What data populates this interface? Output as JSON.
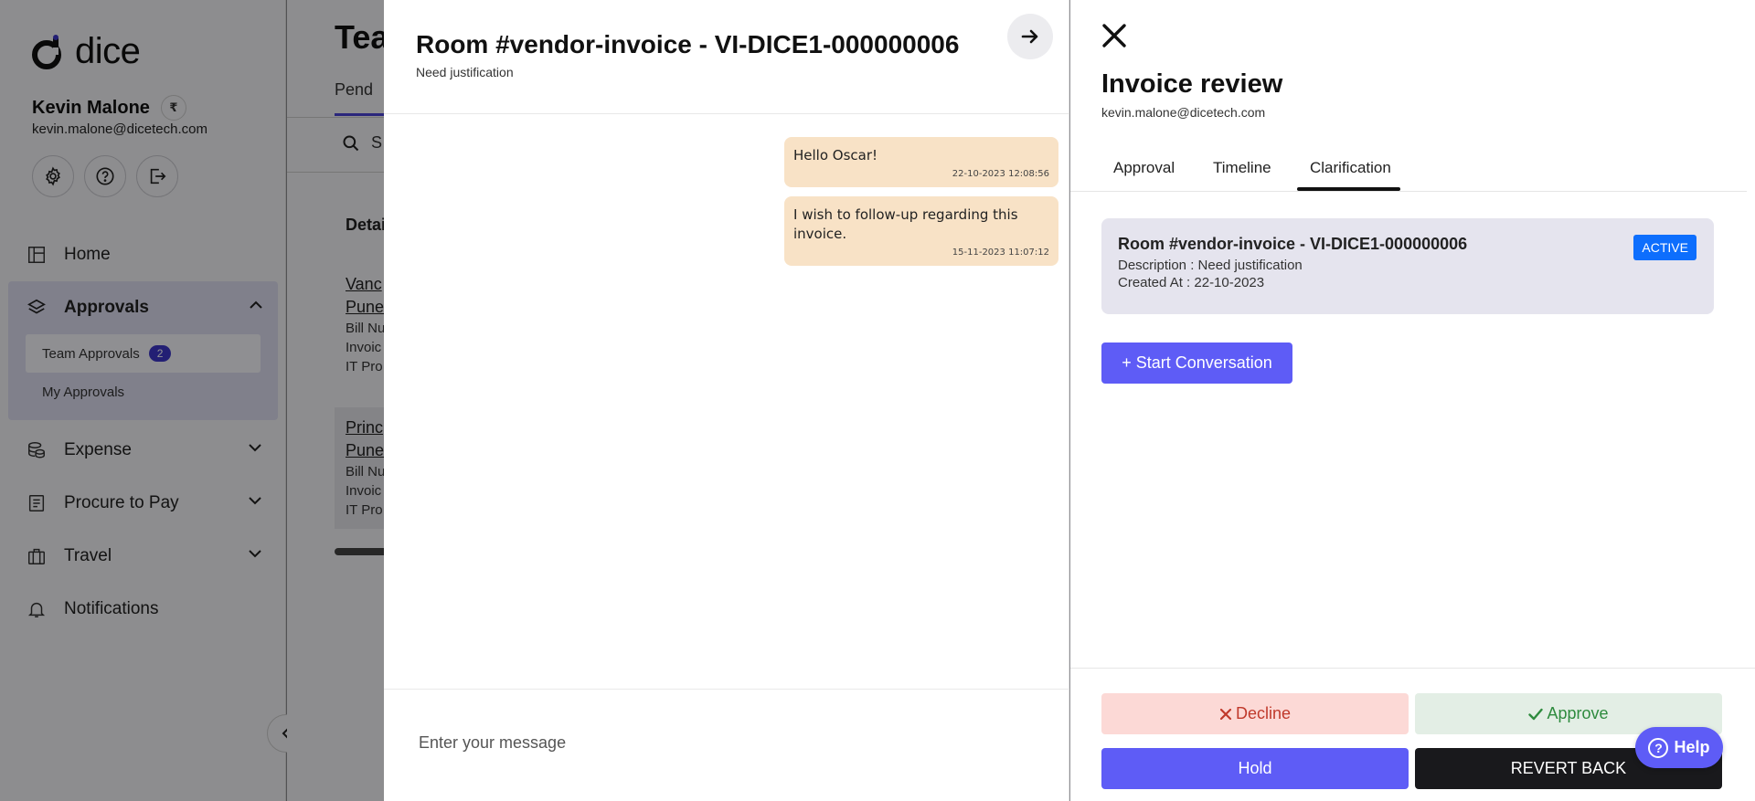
{
  "sidebar": {
    "logo_text": "dice",
    "user_name": "Kevin Malone",
    "currency_symbol": "₹",
    "user_email": "kevin.malone@dicetech.com",
    "nav": {
      "home": "Home",
      "approvals": "Approvals",
      "team_approvals": "Team Approvals",
      "team_approvals_count": "2",
      "my_approvals": "My Approvals",
      "expense": "Expense",
      "procure_to_pay": "Procure to Pay",
      "travel": "Travel",
      "notifications": "Notifications"
    }
  },
  "background": {
    "title": "Tea",
    "tab": "Pend",
    "search": "S",
    "detail_header": "Detai",
    "cards": [
      {
        "line1": "Vanc",
        "line2": "Pune",
        "l3": "Bill Nu",
        "l4": "Invoic",
        "l5": "IT Pro"
      },
      {
        "line1": "Princ",
        "line2": "Pune",
        "l3": "Bill Nu",
        "l4": "Invoic",
        "l5": "IT Pro"
      }
    ]
  },
  "chat": {
    "title": "Room #vendor-invoice - VI-DICE1-000000006",
    "subtitle": "Need justification",
    "messages": [
      {
        "text": "Hello Oscar!",
        "timestamp": "22-10-2023 12:08:56"
      },
      {
        "text": "I wish to follow-up regarding this invoice.",
        "timestamp": "15-11-2023 11:07:12"
      }
    ],
    "input_placeholder": "Enter your message"
  },
  "review": {
    "title": "Invoice review",
    "email": "kevin.malone@dicetech.com",
    "tabs": [
      "Approval",
      "Timeline",
      "Clarification"
    ],
    "active_tab": "Clarification",
    "room": {
      "title": "Room #vendor-invoice - VI-DICE1-000000006",
      "description": "Description : Need justification",
      "created_at": "Created At : 22-10-2023",
      "status": "ACTIVE"
    },
    "start_conversation": "+ Start Conversation",
    "actions": {
      "decline": "Decline",
      "approve": "Approve",
      "hold": "Hold",
      "revert": "REVERT BACK"
    },
    "help": "Help"
  },
  "colors": {
    "primary": "#5e5cf6",
    "message_bubble": "#f8e2c6",
    "active_badge": "#0d6efd",
    "decline_bg": "#fcd9d6",
    "approve_bg": "#e3eee5"
  }
}
